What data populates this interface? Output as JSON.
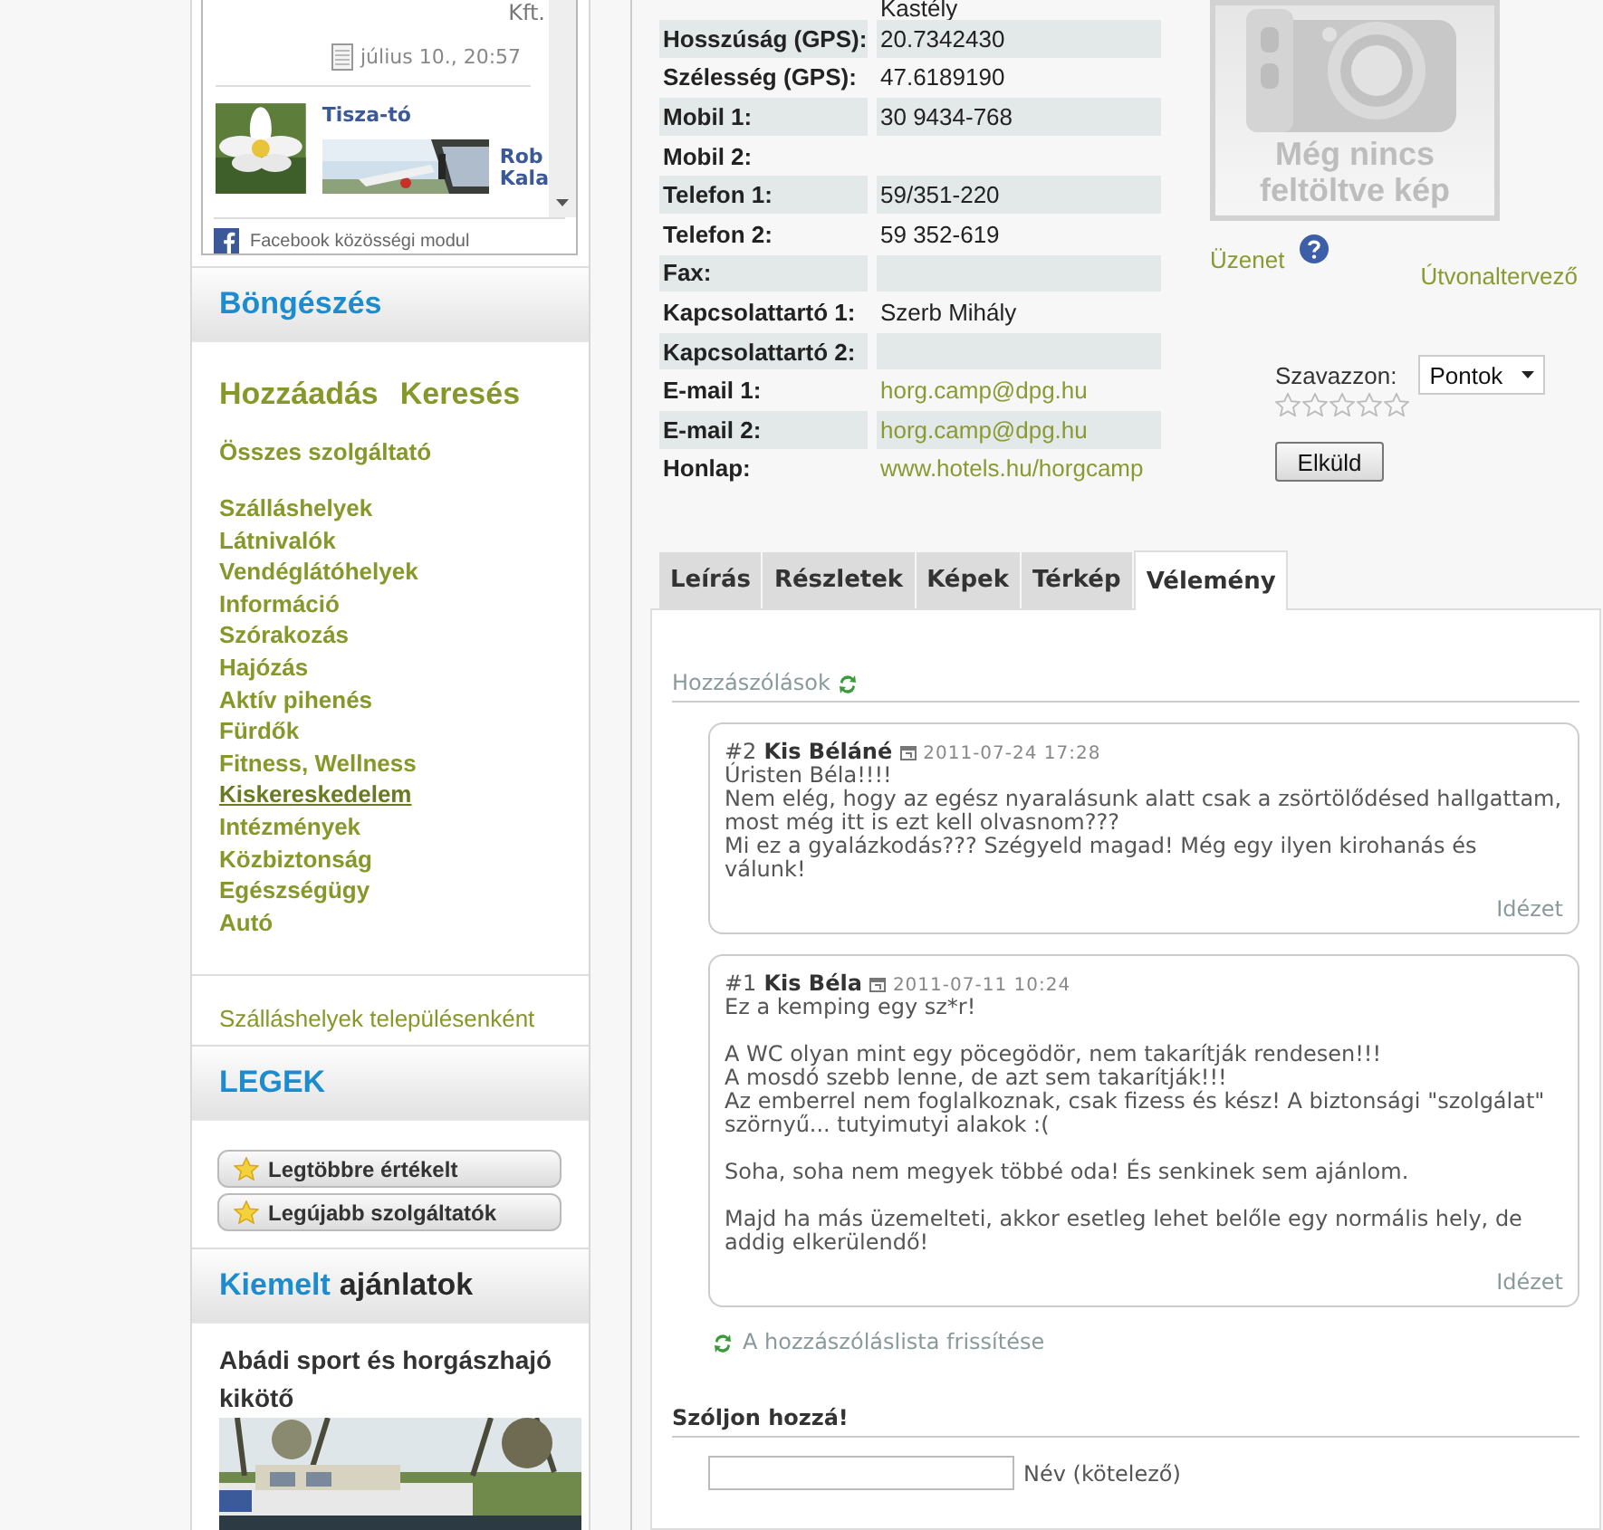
{
  "facebook_module": {
    "top_text": "Kft.",
    "date": "július 10., 20:57",
    "post_title": "Tisza-tó",
    "cut_link_lines": [
      "Rob",
      "Kala"
    ],
    "footer": "Facebook közösségi modul"
  },
  "browse": {
    "title": "Böngészés",
    "actions": [
      "Hozzáadás",
      "Keresés"
    ],
    "all_link": "Összes szolgáltató",
    "categories": [
      {
        "label": "Szálláshelyek",
        "hovered": false
      },
      {
        "label": "Látnivalók",
        "hovered": false
      },
      {
        "label": "Vendéglátóhelyek",
        "hovered": false
      },
      {
        "label": "Információ",
        "hovered": false
      },
      {
        "label": "Szórakozás",
        "hovered": false
      },
      {
        "label": "Hajózás",
        "hovered": false
      },
      {
        "label": "Aktív pihenés",
        "hovered": false
      },
      {
        "label": "Fürdők",
        "hovered": false
      },
      {
        "label": "Fitness, Wellness",
        "hovered": false
      },
      {
        "label": "Kiskereskedelem",
        "hovered": true
      },
      {
        "label": "Intézmények",
        "hovered": false
      },
      {
        "label": "Közbiztonság",
        "hovered": false
      },
      {
        "label": "Egészségügy",
        "hovered": false
      },
      {
        "label": "Autó",
        "hovered": false
      }
    ],
    "by_town_link": "Szálláshelyek településenként"
  },
  "best": {
    "title": "LEGEK",
    "buttons": [
      "Legtöbbre értékelt",
      "Legújabb szolgáltatók"
    ]
  },
  "featured": {
    "title_highlight": "Kiemelt",
    "title_rest": "ajánlatok",
    "item_title": "Abádi sport és horgászhajó kikötő"
  },
  "details": [
    {
      "value": "Kastély",
      "kind": "text"
    },
    {
      "label": "Hosszúság (GPS):",
      "value": "20.7342430",
      "kind": "text"
    },
    {
      "label": "Szélesség (GPS):",
      "value": "47.6189190",
      "kind": "text"
    },
    {
      "label": "Mobil 1:",
      "value": "30 9434-768",
      "kind": "text"
    },
    {
      "label": "Mobil 2:"
    },
    {
      "label": "Telefon 1:",
      "value": "59/351-220",
      "kind": "text"
    },
    {
      "label": "Telefon 2:",
      "value": "59 352-619",
      "kind": "text"
    },
    {
      "label": "Fax:"
    },
    {
      "label": "Kapcsolattartó 1:",
      "value": "Szerb Mihály",
      "kind": "text"
    },
    {
      "label": "Kapcsolattartó 2:"
    },
    {
      "label": "E-mail 1:",
      "value": "horg.camp@dpg.hu",
      "kind": "link"
    },
    {
      "label": "E-mail 2:",
      "value": "horg.camp@dpg.hu",
      "kind": "link"
    },
    {
      "label": "Honlap:",
      "value": "www.hotels.hu/horgcamp",
      "kind": "link"
    }
  ],
  "photo_placeholder": {
    "text": "Még nincs feltöltve kép"
  },
  "message_link": "Üzenet",
  "route_link": "Útvonaltervező",
  "vote": {
    "label": "Szavazzon:",
    "select_value": "Pontok",
    "stars": 0,
    "submit": "Elküld"
  },
  "tabs": [
    {
      "label": "Leírás",
      "selected": false
    },
    {
      "label": "Részletek",
      "selected": false
    },
    {
      "label": "Képek",
      "selected": false
    },
    {
      "label": "Térkép",
      "selected": false
    },
    {
      "label": "Vélemény",
      "selected": true
    }
  ],
  "comments_title": "Hozzászólások",
  "comments": [
    {
      "number": "#2",
      "author": "Kis Béláné",
      "date": "2011-07-24 17:28",
      "paragraphs": [
        "Úristen Béla!!!!\nNem elég, hogy az egész nyaralásunk alatt csak a zsörtölődésed hallgattam, most még itt is ezt kell olvasnom???\nMi ez a gyalázkodás??? Szégyeld magad! Még egy ilyen kirohanás és válunk!"
      ],
      "quote": "Idézet"
    },
    {
      "number": "#1",
      "author": "Kis Béla",
      "date": "2011-07-11 10:24",
      "paragraphs": [
        "Ez a kemping egy sz*r!",
        "A WC olyan mint egy pöcegödör, nem takarítják rendesen!!!\nA mosdó szebb lenne, de azt sem takarítják!!!\nAz emberrel nem foglalkoznak, csak fizess és kész! A biztonsági \"szolgálat\" szörnyű... tutyimutyi alakok :(",
        "Soha, soha nem megyek többé oda! És senkinek sem ajánlom.",
        "Majd ha más üzemelteti, akkor esetleg lehet belőle egy normális hely, de addig elkerülendő!"
      ],
      "quote": "Idézet"
    }
  ],
  "refresh_link": "A hozzászóláslista frissítése",
  "comment_form": {
    "title": "Szóljon hozzá!",
    "name_label": "Név (kötelező)"
  }
}
